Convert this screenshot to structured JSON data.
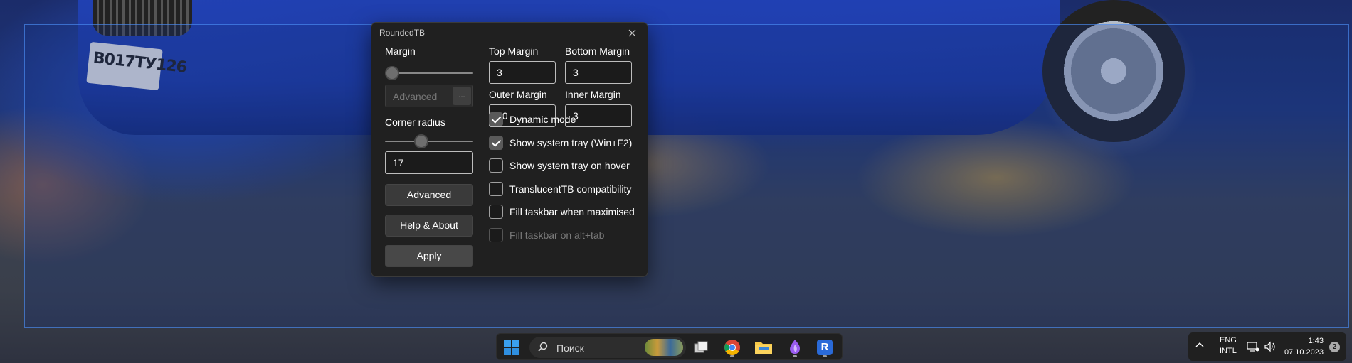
{
  "wallpaper": {
    "plate_text": "В017ТУ126"
  },
  "dialog": {
    "title": "RoundedTB",
    "margin_label": "Margin",
    "margin_slider": 0,
    "advanced_placeholder": "Advanced",
    "advanced_dots": "...",
    "corner_radius_label": "Corner radius",
    "corner_radius_slider": 0.39,
    "corner_radius_value": "17",
    "advanced_button": "Advanced",
    "help_button": "Help & About",
    "apply_button": "Apply",
    "top_margin_label": "Top Margin",
    "top_margin_value": "3",
    "bottom_margin_label": "Bottom Margin",
    "bottom_margin_value": "3",
    "outer_margin_label": "Outer Margin",
    "outer_margin_value": "10",
    "inner_margin_label": "Inner Margin",
    "inner_margin_value": "3",
    "options": [
      {
        "label": "Dynamic mode",
        "checked": true,
        "disabled": false
      },
      {
        "label": "Show system tray (Win+F2)",
        "checked": true,
        "disabled": false
      },
      {
        "label": "Show system tray on hover",
        "checked": false,
        "disabled": false
      },
      {
        "label": "TranslucentTB compatibility",
        "checked": false,
        "disabled": false
      },
      {
        "label": "Fill taskbar when maximised",
        "checked": false,
        "disabled": false
      },
      {
        "label": "Fill taskbar on alt+tab",
        "checked": false,
        "disabled": true
      }
    ]
  },
  "taskbar": {
    "search_placeholder": "Поиск",
    "apps": [
      "start-icon",
      "task-view-icon",
      "chrome-icon",
      "file-explorer-icon",
      "purple-app-icon",
      "roundedtb-icon"
    ],
    "roundedtb_letter": "R"
  },
  "tray": {
    "lang_line1": "ENG",
    "lang_line2": "INTL",
    "time": "1:43",
    "date": "07.10.2023",
    "notifications": "2"
  },
  "colors": {
    "accent": "#0078d4",
    "dialog_bg": "#202020",
    "taskbar_bg": "#202020"
  }
}
